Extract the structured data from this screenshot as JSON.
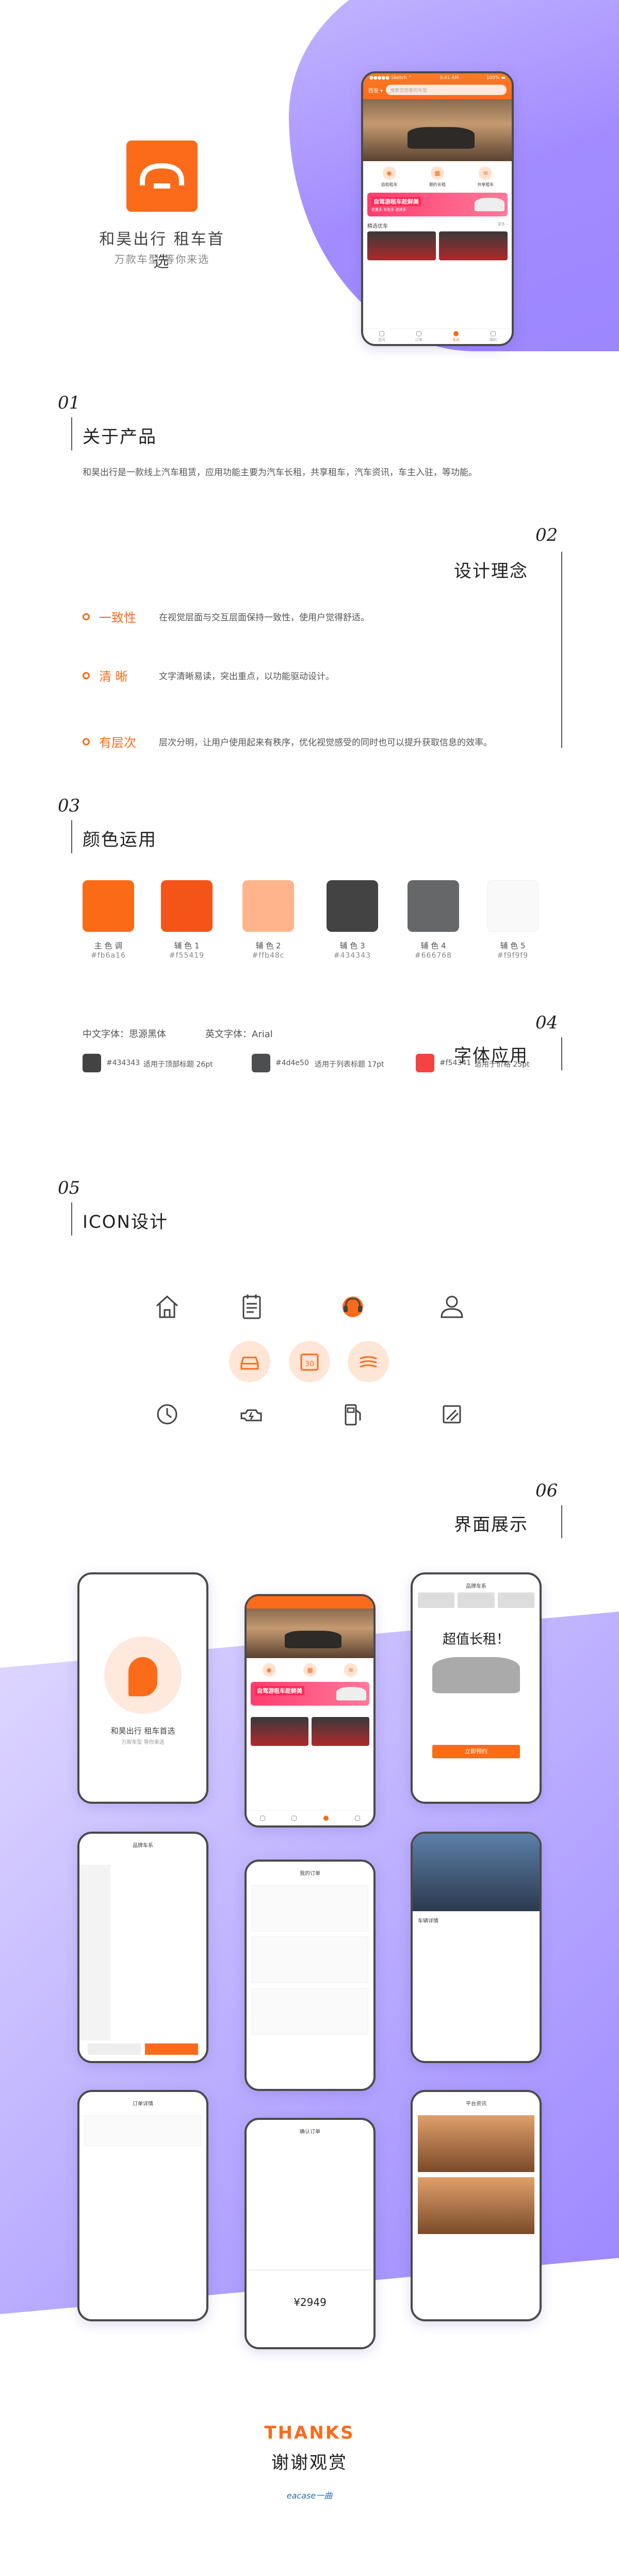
{
  "hero": {
    "title": "和昊出行  租车首选",
    "subtitle": "万款车型 等你来选"
  },
  "phone_home": {
    "status_left": "●●●●● Sketch ⌃",
    "status_center": "9:41 AM",
    "status_right": "100% ▬",
    "city": "西安 ▾",
    "search_placeholder": "搜索您想要的车型",
    "features": [
      "自助租车",
      "期约长租",
      "共享租车"
    ],
    "promo_title": "自驾游租车趁鲜美",
    "promo_sub": "优惠多 车型多 选择多",
    "section_title": "精选优车",
    "section_more": "更多 ›",
    "tabs": [
      "首页",
      "订单",
      "车讯",
      "我的"
    ]
  },
  "section01": {
    "num": "01",
    "title": "关于产品",
    "text": "和昊出行是一款线上汽车租赁，应用功能主要为汽车长租，共享租车，汽车资讯，车主入驻，等功能。"
  },
  "section02": {
    "num": "02",
    "title": "设计理念",
    "items": [
      {
        "name": "一致性",
        "text": "在视觉层面与交互层面保持一致性，使用户觉得舒适。"
      },
      {
        "name": "清  晰",
        "text": "文字清晰易读，突出重点，以功能驱动设计。"
      },
      {
        "name": "有层次",
        "text": "层次分明，让用户使用起来有秩序，优化视觉感受的同时也可以提升获取信息的效率。"
      }
    ]
  },
  "section03": {
    "num": "03",
    "title": "颜色运用",
    "swatches": [
      {
        "label": "主 色 调",
        "hex": "#fb6a16",
        "color": "#fb6a16"
      },
      {
        "label": "辅 色 1",
        "hex": "#f55419",
        "color": "#f55419"
      },
      {
        "label": "辅 色 2",
        "hex": "#ffb48c",
        "color": "#ffb48c"
      },
      {
        "label": "辅 色 3",
        "hex": "#434343",
        "color": "#434343"
      },
      {
        "label": "辅 色 4",
        "hex": "#666768",
        "color": "#666768"
      },
      {
        "label": "辅 色 5",
        "hex": "#f9f9f9",
        "color": "#f9f9f9"
      }
    ]
  },
  "section04": {
    "num": "04",
    "title": "字体应用",
    "cn_font": "中文字体：思源黑体",
    "en_font": "英文字体：Arial",
    "samples": [
      {
        "hex": "#434343",
        "desc": "适用于顶部标题  26pt",
        "color": "#434343"
      },
      {
        "hex": "#4d4e50",
        "desc": "适用于列表标题  17pt",
        "color": "#4d4e50"
      },
      {
        "hex": "#f54341",
        "desc": "适用于价格  25pt",
        "color": "#f54341"
      }
    ]
  },
  "section05": {
    "num": "05",
    "title": "ICON设计",
    "icons": [
      "home-icon",
      "clipboard-icon",
      "service-headset-icon",
      "user-icon",
      "car-front-icon",
      "calendar-30-icon",
      "road-icon",
      "clock-icon",
      "engine-icon",
      "fuel-pump-icon",
      "edit-slash-icon"
    ],
    "calendar_num": "30"
  },
  "section06": {
    "num": "06",
    "title": "界面展示",
    "splash_title": "和昊出行  租车首选",
    "splash_sub": "万款车型 等你来选",
    "promo_big": "超值长租！",
    "promo_btn": "立即预约",
    "price_screen": "¥2949",
    "screen_titles": [
      "品牌车系",
      "我的订单",
      "车辆详情",
      "订单详情",
      "确认订单",
      "平台资讯"
    ]
  },
  "footer": {
    "thanks": "THANKS",
    "thanks_cn": "谢谢观赏",
    "brand": "eacase一曲"
  },
  "colors": {
    "primary": "#fb6b1a",
    "purple": "#a38bff"
  }
}
